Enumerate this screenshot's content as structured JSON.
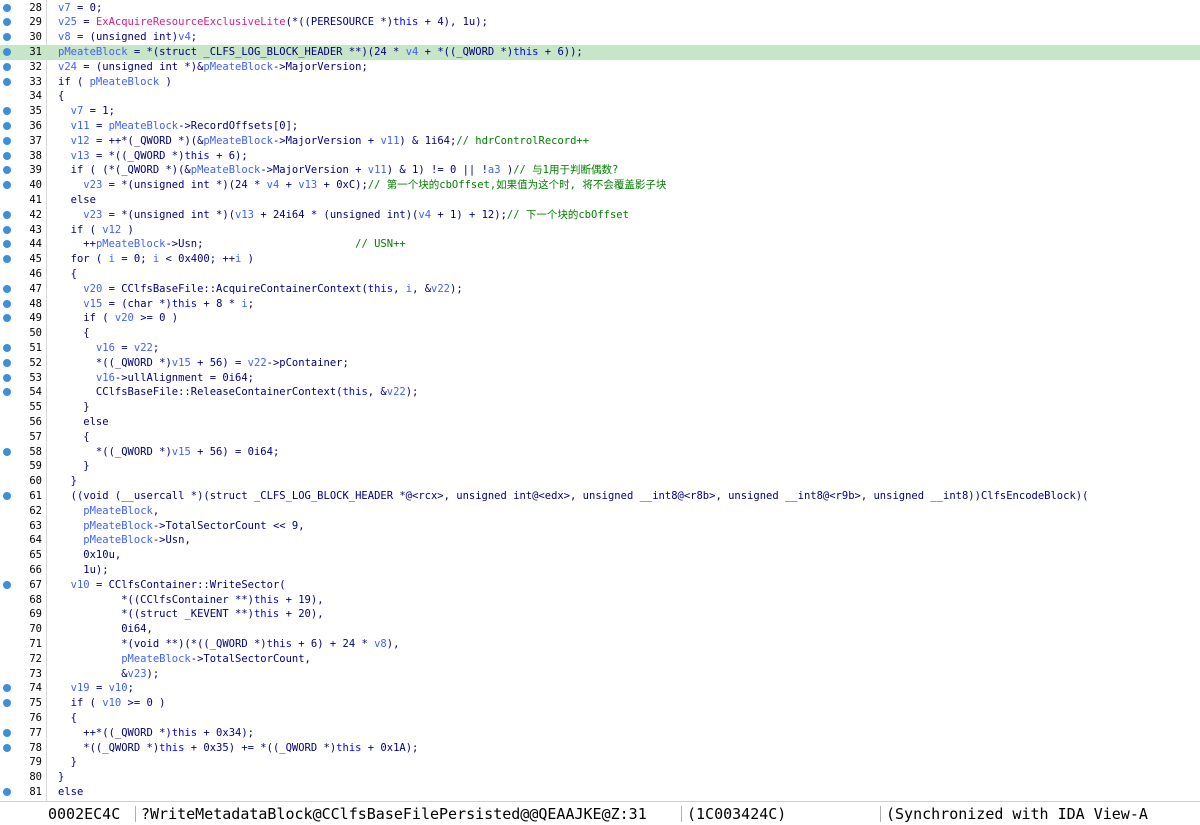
{
  "colors": {
    "highlight": "#c7e6c7",
    "breakpoint": "#3c8fd8",
    "function": "#d0208a",
    "keyword": "#0000ff",
    "variable": "#4060ff",
    "comment": "#008000",
    "text": "#000080"
  },
  "code_view": {
    "highlighted_line": 31,
    "lines": [
      {
        "num": "28",
        "bp": true,
        "tokens": [
          {
            "t": "var",
            "v": "v7"
          },
          {
            "t": "txt",
            "v": " = 0;"
          }
        ]
      },
      {
        "num": "29",
        "bp": true,
        "tokens": [
          {
            "t": "var",
            "v": "v25"
          },
          {
            "t": "txt",
            "v": " = "
          },
          {
            "t": "fn",
            "v": "ExAcquireResourceExclusiveLite"
          },
          {
            "t": "txt",
            "v": "(*((PERESOURCE *)"
          },
          {
            "t": "kw",
            "v": "this"
          },
          {
            "t": "txt",
            "v": " + 4), 1u);"
          }
        ]
      },
      {
        "num": "30",
        "bp": true,
        "tokens": [
          {
            "t": "var",
            "v": "v8"
          },
          {
            "t": "txt",
            "v": " = (unsigned int)"
          },
          {
            "t": "var",
            "v": "v4"
          },
          {
            "t": "txt",
            "v": ";"
          }
        ]
      },
      {
        "num": "31",
        "bp": true,
        "tokens": [
          {
            "t": "var",
            "v": "pMeateBlock"
          },
          {
            "t": "txt",
            "v": " = *(struct _CLFS_LOG_BLOCK_HEADER **)(24 * "
          },
          {
            "t": "var",
            "v": "v4"
          },
          {
            "t": "txt",
            "v": " + *((_QWORD *)"
          },
          {
            "t": "kw",
            "v": "this"
          },
          {
            "t": "txt",
            "v": " + 6));"
          }
        ]
      },
      {
        "num": "32",
        "bp": true,
        "tokens": [
          {
            "t": "var",
            "v": "v24"
          },
          {
            "t": "txt",
            "v": " = (unsigned int *)&"
          },
          {
            "t": "var",
            "v": "pMeateBlock"
          },
          {
            "t": "txt",
            "v": "->MajorVersion;"
          }
        ]
      },
      {
        "num": "33",
        "bp": true,
        "tokens": [
          {
            "t": "txt",
            "v": "if ( "
          },
          {
            "t": "var",
            "v": "pMeateBlock"
          },
          {
            "t": "txt",
            "v": " )"
          }
        ]
      },
      {
        "num": "34",
        "bp": false,
        "tokens": [
          {
            "t": "txt",
            "v": "{"
          }
        ]
      },
      {
        "num": "35",
        "bp": true,
        "tokens": [
          {
            "t": "txt",
            "v": "  "
          },
          {
            "t": "var",
            "v": "v7"
          },
          {
            "t": "txt",
            "v": " = 1;"
          }
        ]
      },
      {
        "num": "36",
        "bp": true,
        "tokens": [
          {
            "t": "txt",
            "v": "  "
          },
          {
            "t": "var",
            "v": "v11"
          },
          {
            "t": "txt",
            "v": " = "
          },
          {
            "t": "var",
            "v": "pMeateBlock"
          },
          {
            "t": "txt",
            "v": "->RecordOffsets[0];"
          }
        ]
      },
      {
        "num": "37",
        "bp": true,
        "tokens": [
          {
            "t": "txt",
            "v": "  "
          },
          {
            "t": "var",
            "v": "v12"
          },
          {
            "t": "txt",
            "v": " = ++*(_QWORD *)(&"
          },
          {
            "t": "var",
            "v": "pMeateBlock"
          },
          {
            "t": "txt",
            "v": "->MajorVersion + "
          },
          {
            "t": "var",
            "v": "v11"
          },
          {
            "t": "txt",
            "v": ") & 1i64;"
          },
          {
            "t": "cmt",
            "v": "// hdrControlRecord++"
          }
        ]
      },
      {
        "num": "38",
        "bp": true,
        "tokens": [
          {
            "t": "txt",
            "v": "  "
          },
          {
            "t": "var",
            "v": "v13"
          },
          {
            "t": "txt",
            "v": " = *((_QWORD *)"
          },
          {
            "t": "kw",
            "v": "this"
          },
          {
            "t": "txt",
            "v": " + 6);"
          }
        ]
      },
      {
        "num": "39",
        "bp": true,
        "tokens": [
          {
            "t": "txt",
            "v": "  if ( (*(_QWORD *)(&"
          },
          {
            "t": "var",
            "v": "pMeateBlock"
          },
          {
            "t": "txt",
            "v": "->MajorVersion + "
          },
          {
            "t": "var",
            "v": "v11"
          },
          {
            "t": "txt",
            "v": ") & 1) != 0 || !"
          },
          {
            "t": "var",
            "v": "a3"
          },
          {
            "t": "txt",
            "v": " )"
          },
          {
            "t": "cmt",
            "v": "// 与1用于判断偶数?"
          }
        ]
      },
      {
        "num": "40",
        "bp": true,
        "tokens": [
          {
            "t": "txt",
            "v": "    "
          },
          {
            "t": "var",
            "v": "v23"
          },
          {
            "t": "txt",
            "v": " = *(unsigned int *)(24 * "
          },
          {
            "t": "var",
            "v": "v4"
          },
          {
            "t": "txt",
            "v": " + "
          },
          {
            "t": "var",
            "v": "v13"
          },
          {
            "t": "txt",
            "v": " + 0xC);"
          },
          {
            "t": "cmt",
            "v": "// 第一个块的cbOffset,如果值为这个时, 将不会覆盖影子块"
          }
        ]
      },
      {
        "num": "41",
        "bp": false,
        "tokens": [
          {
            "t": "txt",
            "v": "  else"
          }
        ]
      },
      {
        "num": "42",
        "bp": true,
        "tokens": [
          {
            "t": "txt",
            "v": "    "
          },
          {
            "t": "var",
            "v": "v23"
          },
          {
            "t": "txt",
            "v": " = *(unsigned int *)("
          },
          {
            "t": "var",
            "v": "v13"
          },
          {
            "t": "txt",
            "v": " + 24i64 * (unsigned int)("
          },
          {
            "t": "var",
            "v": "v4"
          },
          {
            "t": "txt",
            "v": " + 1) + 12);"
          },
          {
            "t": "cmt",
            "v": "// 下一个块的cbOffset"
          }
        ]
      },
      {
        "num": "43",
        "bp": true,
        "tokens": [
          {
            "t": "txt",
            "v": "  if ( "
          },
          {
            "t": "var",
            "v": "v12"
          },
          {
            "t": "txt",
            "v": " )"
          }
        ]
      },
      {
        "num": "44",
        "bp": true,
        "tokens": [
          {
            "t": "txt",
            "v": "    ++"
          },
          {
            "t": "var",
            "v": "pMeateBlock"
          },
          {
            "t": "txt",
            "v": "->Usn;                        "
          },
          {
            "t": "cmt",
            "v": "// USN++"
          }
        ]
      },
      {
        "num": "45",
        "bp": true,
        "tokens": [
          {
            "t": "txt",
            "v": "  for ( "
          },
          {
            "t": "var",
            "v": "i"
          },
          {
            "t": "txt",
            "v": " = 0; "
          },
          {
            "t": "var",
            "v": "i"
          },
          {
            "t": "txt",
            "v": " < 0x400; ++"
          },
          {
            "t": "var",
            "v": "i"
          },
          {
            "t": "txt",
            "v": " )"
          }
        ]
      },
      {
        "num": "46",
        "bp": false,
        "tokens": [
          {
            "t": "txt",
            "v": "  {"
          }
        ]
      },
      {
        "num": "47",
        "bp": true,
        "tokens": [
          {
            "t": "txt",
            "v": "    "
          },
          {
            "t": "var",
            "v": "v20"
          },
          {
            "t": "txt",
            "v": " = CClfsBaseFile::AcquireContainerContext("
          },
          {
            "t": "kw",
            "v": "this"
          },
          {
            "t": "txt",
            "v": ", "
          },
          {
            "t": "var",
            "v": "i"
          },
          {
            "t": "txt",
            "v": ", &"
          },
          {
            "t": "var",
            "v": "v22"
          },
          {
            "t": "txt",
            "v": ");"
          }
        ]
      },
      {
        "num": "48",
        "bp": true,
        "tokens": [
          {
            "t": "txt",
            "v": "    "
          },
          {
            "t": "var",
            "v": "v15"
          },
          {
            "t": "txt",
            "v": " = (char *)"
          },
          {
            "t": "kw",
            "v": "this"
          },
          {
            "t": "txt",
            "v": " + 8 * "
          },
          {
            "t": "var",
            "v": "i"
          },
          {
            "t": "txt",
            "v": ";"
          }
        ]
      },
      {
        "num": "49",
        "bp": true,
        "tokens": [
          {
            "t": "txt",
            "v": "    if ( "
          },
          {
            "t": "var",
            "v": "v20"
          },
          {
            "t": "txt",
            "v": " >= 0 )"
          }
        ]
      },
      {
        "num": "50",
        "bp": false,
        "tokens": [
          {
            "t": "txt",
            "v": "    {"
          }
        ]
      },
      {
        "num": "51",
        "bp": true,
        "tokens": [
          {
            "t": "txt",
            "v": "      "
          },
          {
            "t": "var",
            "v": "v16"
          },
          {
            "t": "txt",
            "v": " = "
          },
          {
            "t": "var",
            "v": "v22"
          },
          {
            "t": "txt",
            "v": ";"
          }
        ]
      },
      {
        "num": "52",
        "bp": true,
        "tokens": [
          {
            "t": "txt",
            "v": "      *((_QWORD *)"
          },
          {
            "t": "var",
            "v": "v15"
          },
          {
            "t": "txt",
            "v": " + 56) = "
          },
          {
            "t": "var",
            "v": "v22"
          },
          {
            "t": "txt",
            "v": "->pContainer;"
          }
        ]
      },
      {
        "num": "53",
        "bp": true,
        "tokens": [
          {
            "t": "txt",
            "v": "      "
          },
          {
            "t": "var",
            "v": "v16"
          },
          {
            "t": "txt",
            "v": "->ullAlignment = 0i64;"
          }
        ]
      },
      {
        "num": "54",
        "bp": true,
        "tokens": [
          {
            "t": "txt",
            "v": "      CClfsBaseFile::ReleaseContainerContext("
          },
          {
            "t": "kw",
            "v": "this"
          },
          {
            "t": "txt",
            "v": ", &"
          },
          {
            "t": "var",
            "v": "v22"
          },
          {
            "t": "txt",
            "v": ");"
          }
        ]
      },
      {
        "num": "55",
        "bp": false,
        "tokens": [
          {
            "t": "txt",
            "v": "    }"
          }
        ]
      },
      {
        "num": "56",
        "bp": false,
        "tokens": [
          {
            "t": "txt",
            "v": "    else"
          }
        ]
      },
      {
        "num": "57",
        "bp": false,
        "tokens": [
          {
            "t": "txt",
            "v": "    {"
          }
        ]
      },
      {
        "num": "58",
        "bp": true,
        "tokens": [
          {
            "t": "txt",
            "v": "      *((_QWORD *)"
          },
          {
            "t": "var",
            "v": "v15"
          },
          {
            "t": "txt",
            "v": " + 56) = 0i64;"
          }
        ]
      },
      {
        "num": "59",
        "bp": false,
        "tokens": [
          {
            "t": "txt",
            "v": "    }"
          }
        ]
      },
      {
        "num": "60",
        "bp": false,
        "tokens": [
          {
            "t": "txt",
            "v": "  }"
          }
        ]
      },
      {
        "num": "61",
        "bp": true,
        "tokens": [
          {
            "t": "txt",
            "v": "  ((void (__usercall *)(struct _CLFS_LOG_BLOCK_HEADER *@<rcx>, unsigned int@<edx>, unsigned __int8@<r8b>, unsigned __int8@<r9b>, unsigned __int8))ClfsEncodeBlock)("
          }
        ]
      },
      {
        "num": "62",
        "bp": false,
        "tokens": [
          {
            "t": "txt",
            "v": "    "
          },
          {
            "t": "var",
            "v": "pMeateBlock"
          },
          {
            "t": "txt",
            "v": ","
          }
        ]
      },
      {
        "num": "63",
        "bp": false,
        "tokens": [
          {
            "t": "txt",
            "v": "    "
          },
          {
            "t": "var",
            "v": "pMeateBlock"
          },
          {
            "t": "txt",
            "v": "->TotalSectorCount << 9,"
          }
        ]
      },
      {
        "num": "64",
        "bp": false,
        "tokens": [
          {
            "t": "txt",
            "v": "    "
          },
          {
            "t": "var",
            "v": "pMeateBlock"
          },
          {
            "t": "txt",
            "v": "->Usn,"
          }
        ]
      },
      {
        "num": "65",
        "bp": false,
        "tokens": [
          {
            "t": "txt",
            "v": "    0x10u,"
          }
        ]
      },
      {
        "num": "66",
        "bp": false,
        "tokens": [
          {
            "t": "txt",
            "v": "    1u);"
          }
        ]
      },
      {
        "num": "67",
        "bp": true,
        "tokens": [
          {
            "t": "txt",
            "v": "  "
          },
          {
            "t": "var",
            "v": "v10"
          },
          {
            "t": "txt",
            "v": " = CClfsContainer::WriteSector("
          }
        ]
      },
      {
        "num": "68",
        "bp": false,
        "tokens": [
          {
            "t": "txt",
            "v": "          *((CClfsContainer **)"
          },
          {
            "t": "kw",
            "v": "this"
          },
          {
            "t": "txt",
            "v": " + 19),"
          }
        ]
      },
      {
        "num": "69",
        "bp": false,
        "tokens": [
          {
            "t": "txt",
            "v": "          *((struct _KEVENT **)"
          },
          {
            "t": "kw",
            "v": "this"
          },
          {
            "t": "txt",
            "v": " + 20),"
          }
        ]
      },
      {
        "num": "70",
        "bp": false,
        "tokens": [
          {
            "t": "txt",
            "v": "          0i64,"
          }
        ]
      },
      {
        "num": "71",
        "bp": false,
        "tokens": [
          {
            "t": "txt",
            "v": "          *(void **)(*((_QWORD *)"
          },
          {
            "t": "kw",
            "v": "this"
          },
          {
            "t": "txt",
            "v": " + 6) + 24 * "
          },
          {
            "t": "var",
            "v": "v8"
          },
          {
            "t": "txt",
            "v": "),"
          }
        ]
      },
      {
        "num": "72",
        "bp": false,
        "tokens": [
          {
            "t": "txt",
            "v": "          "
          },
          {
            "t": "var",
            "v": "pMeateBlock"
          },
          {
            "t": "txt",
            "v": "->TotalSectorCount,"
          }
        ]
      },
      {
        "num": "73",
        "bp": false,
        "tokens": [
          {
            "t": "txt",
            "v": "          &"
          },
          {
            "t": "var",
            "v": "v23"
          },
          {
            "t": "txt",
            "v": ");"
          }
        ]
      },
      {
        "num": "74",
        "bp": true,
        "tokens": [
          {
            "t": "txt",
            "v": "  "
          },
          {
            "t": "var",
            "v": "v19"
          },
          {
            "t": "txt",
            "v": " = "
          },
          {
            "t": "var",
            "v": "v10"
          },
          {
            "t": "txt",
            "v": ";"
          }
        ]
      },
      {
        "num": "75",
        "bp": true,
        "tokens": [
          {
            "t": "txt",
            "v": "  if ( "
          },
          {
            "t": "var",
            "v": "v10"
          },
          {
            "t": "txt",
            "v": " >= 0 )"
          }
        ]
      },
      {
        "num": "76",
        "bp": false,
        "tokens": [
          {
            "t": "txt",
            "v": "  {"
          }
        ]
      },
      {
        "num": "77",
        "bp": true,
        "tokens": [
          {
            "t": "txt",
            "v": "    ++*((_QWORD *)"
          },
          {
            "t": "kw",
            "v": "this"
          },
          {
            "t": "txt",
            "v": " + 0x34);"
          }
        ]
      },
      {
        "num": "78",
        "bp": true,
        "tokens": [
          {
            "t": "txt",
            "v": "    *((_QWORD *)"
          },
          {
            "t": "kw",
            "v": "this"
          },
          {
            "t": "txt",
            "v": " + 0x35) += *((_QWORD *)"
          },
          {
            "t": "kw",
            "v": "this"
          },
          {
            "t": "txt",
            "v": " + 0x1A);"
          }
        ]
      },
      {
        "num": "79",
        "bp": false,
        "tokens": [
          {
            "t": "txt",
            "v": "  }"
          }
        ]
      },
      {
        "num": "80",
        "bp": false,
        "tokens": [
          {
            "t": "txt",
            "v": "}"
          }
        ]
      },
      {
        "num": "81",
        "bp": true,
        "tokens": [
          {
            "t": "txt",
            "v": "else"
          }
        ]
      }
    ]
  },
  "status_bar": {
    "address": "0002EC4C",
    "location": "?WriteMetadataBlock@CClfsBaseFilePersisted@@QEAAJKE@Z:31",
    "ea": "(1C003424C)",
    "sync": "(Synchronized with IDA View-A"
  }
}
